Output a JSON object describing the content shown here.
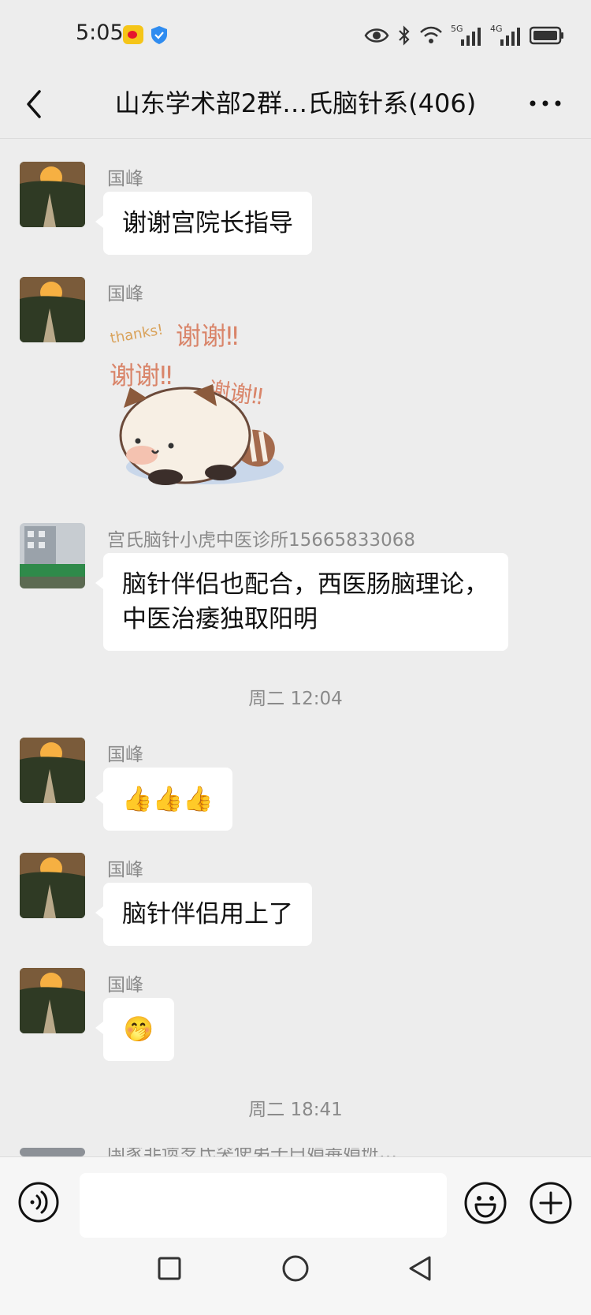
{
  "status_bar": {
    "time": "5:05",
    "network_5g": "5G",
    "network_4g": "4G"
  },
  "header": {
    "title": "山东学术部2群…氏脑针系(406)"
  },
  "messages": [
    {
      "sender": "国峰",
      "type": "text",
      "text": "谢谢宫院长指导"
    },
    {
      "sender": "国峰",
      "type": "sticker",
      "sticker_texts": [
        "thanks!",
        "谢谢‼",
        "谢谢‼",
        "谢谢‼"
      ]
    },
    {
      "sender": "宫氏脑针小虎中医诊所15665833068",
      "type": "text",
      "text": "脑针伴侣也配合，西医肠脑理论，中医治痿独取阳明"
    },
    {
      "sender": "国峰",
      "type": "emoji",
      "emoji": "👍👍👍"
    },
    {
      "sender": "国峰",
      "type": "text",
      "text": "脑针伴侣用上了"
    },
    {
      "sender": "国峰",
      "type": "emoji",
      "emoji": "🤭"
    },
    {
      "sender": "国家非遗罗氏突使弟子白娟毒娟班…",
      "type": "partial"
    }
  ],
  "timestamps": [
    "周二 12:04",
    "周二 18:41"
  ],
  "input": {
    "placeholder": "",
    "icons": [
      "voice-icon",
      "emoji-icon",
      "plus-icon"
    ]
  },
  "colors": {
    "background": "#ededed",
    "bubble": "#ffffff",
    "secondary_text": "#8a8a8a",
    "sticker_text": "#d9856a"
  }
}
